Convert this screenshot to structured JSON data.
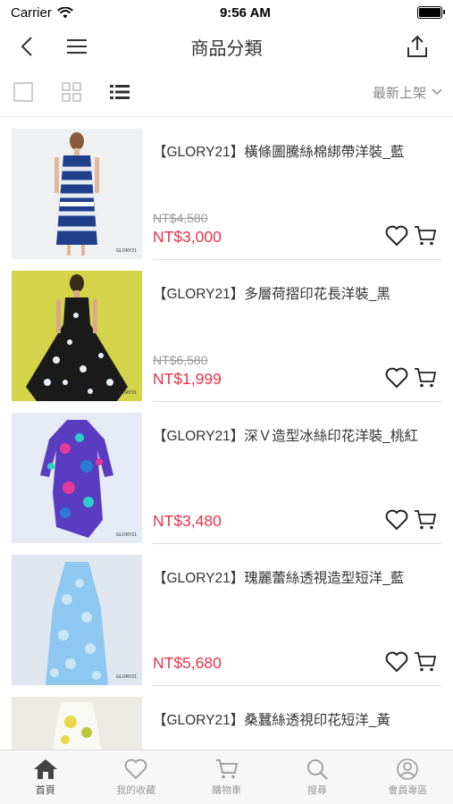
{
  "status": {
    "carrier": "Carrier",
    "time": "9:56 AM"
  },
  "nav": {
    "title": "商品分類"
  },
  "sort": {
    "label": "最新上架"
  },
  "colors": {
    "price": "#e8334a"
  },
  "products": [
    {
      "name": "【GLORY21】橫條圖騰絲棉綁帶洋裝_藍",
      "orig": "NT$4,580",
      "price": "NT$3,000"
    },
    {
      "name": "【GLORY21】多層荷摺印花長洋裝_黑",
      "orig": "NT$6,580",
      "price": "NT$1,999"
    },
    {
      "name": "【GLORY21】深Ｖ造型冰絲印花洋裝_桃紅",
      "orig": "",
      "price": "NT$3,480"
    },
    {
      "name": "【GLORY21】瑰麗蕾絲透視造型短洋_藍",
      "orig": "",
      "price": "NT$5,680"
    },
    {
      "name": "【GLORY21】桑蠶絲透視印花短洋_黃",
      "orig": "",
      "price": ""
    }
  ],
  "watermark": "GLORY21",
  "tabs": [
    {
      "label": "首頁",
      "icon": "home-icon"
    },
    {
      "label": "我的收藏",
      "icon": "heart-icon"
    },
    {
      "label": "購物車",
      "icon": "cart-icon"
    },
    {
      "label": "搜尋",
      "icon": "search-icon"
    },
    {
      "label": "會員專區",
      "icon": "user-icon"
    }
  ]
}
